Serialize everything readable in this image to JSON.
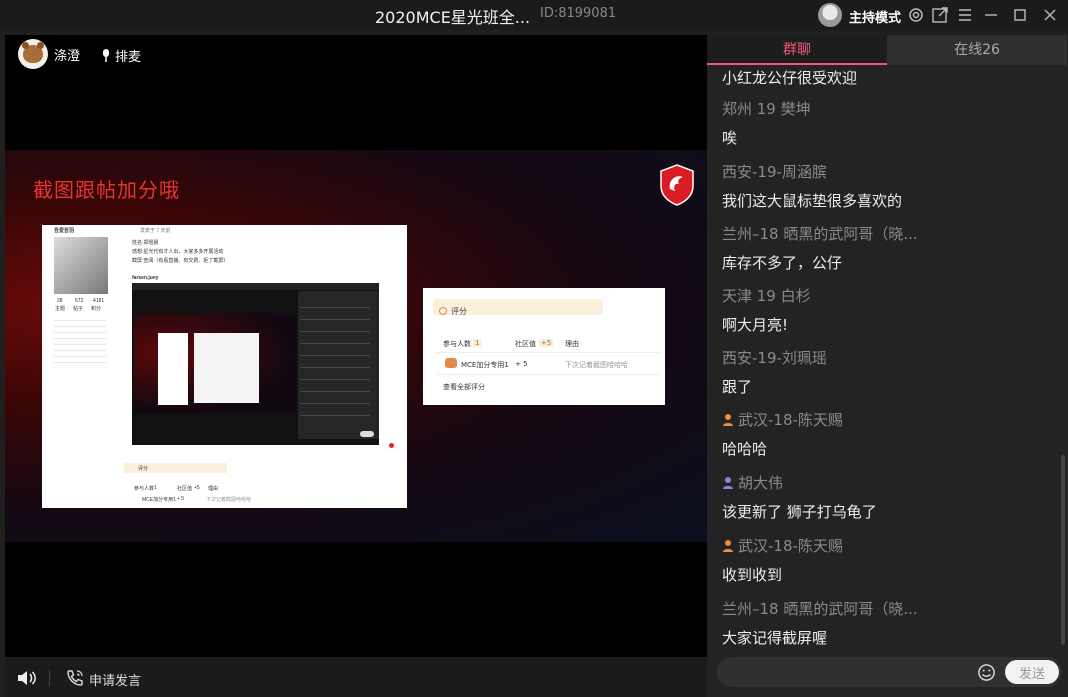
{
  "titlebar": {
    "title": "2020MCE星光班全...",
    "room_id": "ID:8199081",
    "host_mode": "主持模式"
  },
  "presenter": {
    "name": "涤澄",
    "queue_label": "排麦"
  },
  "slide": {
    "title": "截图跟帖加分哦",
    "shot1": {
      "username": "吾爱吾羽",
      "post_note": "发表于 7 天前",
      "lines": [
        "姓名:郑煜晨",
        "感想:星光代有才人出，大家多多开展活动",
        "截屏:查阅（有看直播、有交费、拒了截屏）"
      ],
      "thread_user": "farsen.juey",
      "stats": [
        "28",
        "672",
        "4181"
      ],
      "stat_labels": [
        "主题",
        "帖子",
        "积分"
      ],
      "rating_label": "评分",
      "participants": "参与人数",
      "participant_count": "1",
      "community_label": "社区值",
      "community_value": "+5",
      "reason_label": "理由",
      "rater": "MCE加分专用1",
      "rater_value": "+ 5",
      "rater_reason": "下次记着截图哈哈哈"
    },
    "shot2": {
      "rating_label": "评分",
      "participants": "参与人数",
      "participant_count": "1",
      "community_label": "社区值",
      "community_value": "+5",
      "reason_label": "理由",
      "rater": "MCE加分专用1",
      "rater_value": "+ 5",
      "rater_reason": "下次记着截图哈哈哈",
      "view_all": "查看全部评分"
    }
  },
  "bottom": {
    "apply_label": "申请发言"
  },
  "chat": {
    "tabs": [
      {
        "label": "群聊"
      },
      {
        "label": "在线26"
      }
    ],
    "partial_top": "小红龙公仔很受欢迎",
    "messages": [
      {
        "name": "郑州 19 樊坤",
        "text": "唉",
        "badge": ""
      },
      {
        "name": "西安-19-周涵膑",
        "text": "我们这大鼠标垫很多喜欢的",
        "badge": ""
      },
      {
        "name": "兰州–18 晒黑的武阿哥（晓...",
        "text": "库存不多了，公仔",
        "badge": ""
      },
      {
        "name": "天津 19 白杉",
        "text": "啊大月亮!",
        "badge": ""
      },
      {
        "name": "西安-19-刘珮瑶",
        "text": "跟了",
        "badge": ""
      },
      {
        "name": "武汉-18-陈天赐",
        "text": "哈哈哈",
        "badge": "orange"
      },
      {
        "name": "胡大伟",
        "text": "该更新了  狮子打乌龟了",
        "badge": "purple"
      },
      {
        "name": "武汉-18-陈天赐",
        "text": "收到收到",
        "badge": "orange"
      },
      {
        "name": "兰州–18 晒黑的武阿哥（晓...",
        "text": "大家记得截屏喔",
        "badge": ""
      }
    ],
    "input_placeholder": "",
    "send_label": "发送",
    "badge_colors": {
      "orange": "#e8913a",
      "purple": "#9b7fd6"
    }
  }
}
